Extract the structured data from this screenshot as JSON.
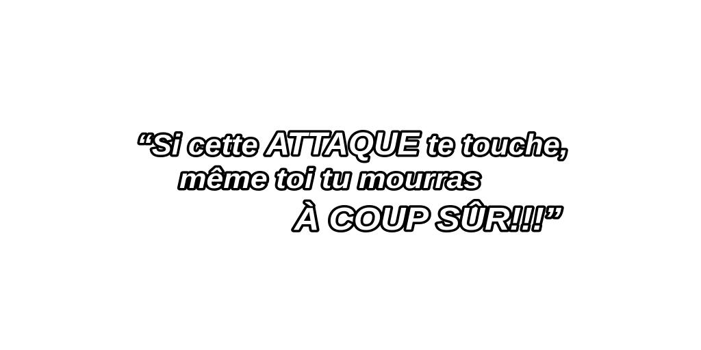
{
  "quote": {
    "line1_open": "“Si cette ",
    "line1_emph": "ATTAQUE",
    "line1_rest": " te touche,",
    "line2": "même toi tu mourras",
    "line3": "À COUP SÛR!!!”"
  },
  "colors": {
    "background": "#ffffff",
    "text_fill": "#ffffff",
    "text_outline": "#000000"
  }
}
